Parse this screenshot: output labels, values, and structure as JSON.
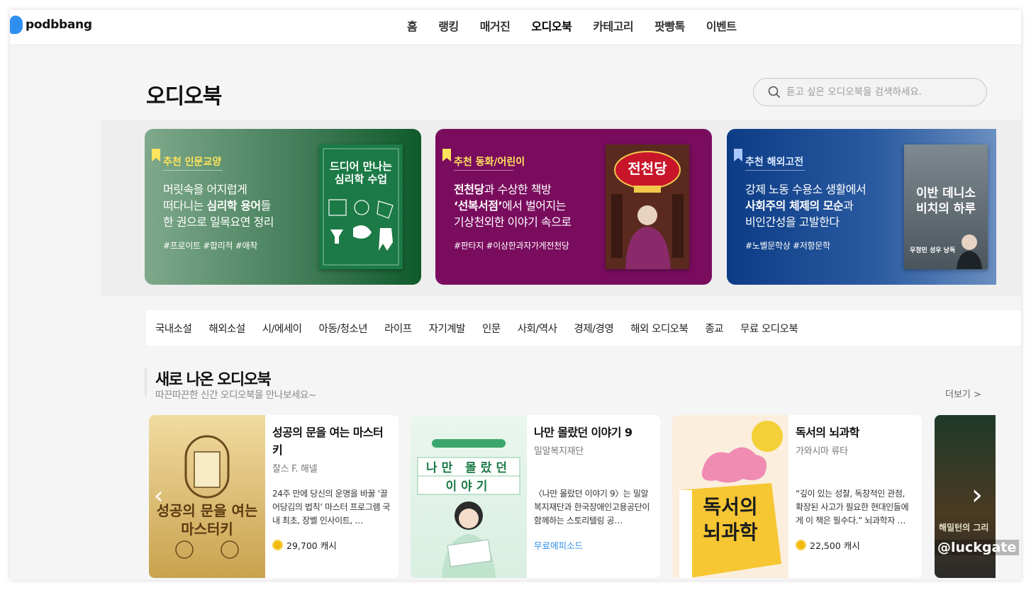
{
  "header": {
    "logo_text": "podbbang",
    "nav": [
      "홈",
      "랭킹",
      "매거진",
      "오디오북",
      "카테고리",
      "팟빵톡",
      "이벤트"
    ],
    "active_nav": "오디오북"
  },
  "page": {
    "title": "오디오북",
    "search_placeholder": "듣고 싶은 오디오북을 검색하세요."
  },
  "banners": [
    {
      "tag": "추천 인문교양",
      "line1": "머릿속을 어지럽게",
      "line2_pre": "떠다니는 ",
      "line2_bold": "심리학 용어",
      "line2_post": "들",
      "line3": "한 권으로 일목요연 정리",
      "hashtags": "#프로이트 #합리적 #애착",
      "cover_text": "드디어 만나는 심리학 수업",
      "tag_color": "#ffe45c"
    },
    {
      "tag": "추천 동화/어린이",
      "line1_bold": "전천당",
      "line1_post": "과 수상한 책방",
      "line2_bold": "‘선복서점’",
      "line2_post": "에서 벌어지는",
      "line3": "기상천외한 이야기 속으로",
      "hashtags": "#판타지 #이상한과자가게전천당",
      "cover_text": "전천당",
      "tag_color": "#ffe45c"
    },
    {
      "tag": "추천 해외고전",
      "line1": "강제 노동 수용소 생활에서",
      "line2_bold": "사회주의 체제의 모순",
      "line2_post": "과",
      "line3": "비인간성을 고발한다",
      "hashtags": "#노벨문학상 #저항문학",
      "cover_text": "이반 데니소비치의 하루",
      "cover_sub": "우정민 성우 낭독",
      "tag_color": "#a9c8ff"
    }
  ],
  "categories": [
    "국내소설",
    "해외소설",
    "시/에세이",
    "아동/청소년",
    "라이프",
    "자기계발",
    "인문",
    "사회/역사",
    "경제/경영",
    "해외 오디오북",
    "종교",
    "무료 오디오북"
  ],
  "section": {
    "title": "새로 나온 오디오북",
    "subtitle": "따끈따끈한 신간 오디오북을 만나보세요~",
    "more": "더보기 >"
  },
  "books": [
    {
      "title": "성공의 문을 여는 마스터키",
      "author": "찰스 F. 해넬",
      "desc": "24주 만에 당신의 운명을 바꿀 ‘끌어당김의 법칙’ 마스터 프로그램 국내 최초, 장벨 인사이트, …",
      "price": "29,700 캐시",
      "cover_text": "성공의 문을 여는 마스터키"
    },
    {
      "title": "나만 몰랐던 이야기 9",
      "author": "밀알복지재단",
      "desc": "〈나만 몰랐던 이야기 9〉는 밀알복지재단과 한국장애인고용공단이 함께하는 스토리텔링 공…",
      "price": "무료에피소드",
      "cover_text": "나만 몰랐던 이야기"
    },
    {
      "title": "독서의 뇌과학",
      "author": "가와시마 류타",
      "desc": "“깊이 있는 성찰, 독창적인 관점, 확장된 사고가 필요한 현대인들에게 이 책은 필수다.” 뇌과학자 …",
      "price": "22,500 캐시",
      "cover_text": "독서의 뇌과학"
    },
    {
      "title": "",
      "cover_text": "해밀턴의 그리"
    }
  ],
  "watermark": "@luckgate"
}
